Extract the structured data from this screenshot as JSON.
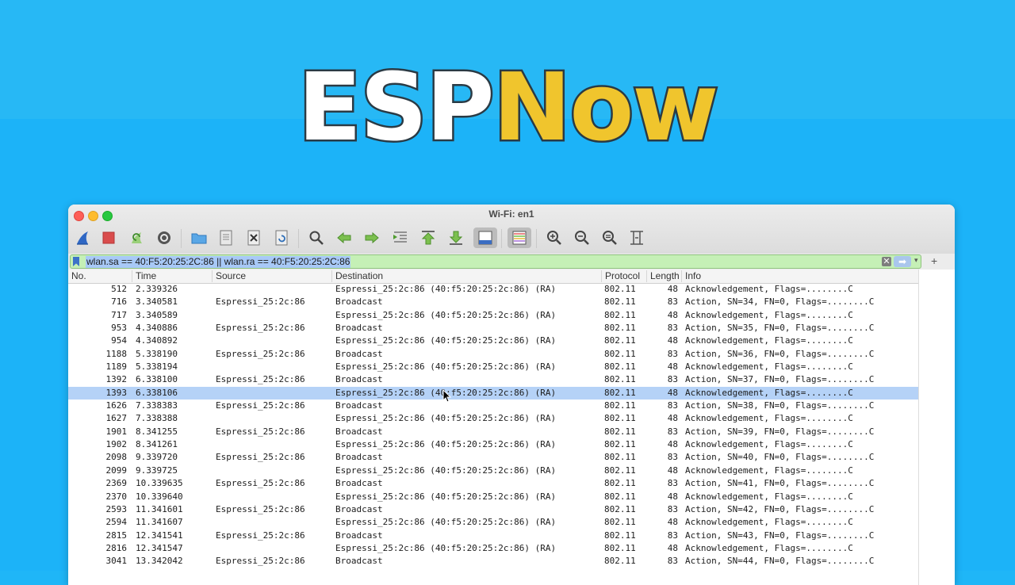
{
  "banner": {
    "title_part1": "ESP",
    "title_part2": "Now"
  },
  "window": {
    "title": "Wi-Fi: en1"
  },
  "toolbar": {
    "icons": [
      "shark-fin-icon",
      "stop-icon",
      "restart-icon",
      "options-gear-icon",
      "open-folder-icon",
      "save-file-icon",
      "close-file-icon",
      "reload-icon",
      "find-icon",
      "back-arrow-icon",
      "forward-arrow-icon",
      "go-to-packet-icon",
      "first-packet-icon",
      "last-packet-icon",
      "autoscroll-icon",
      "colorize-icon",
      "zoom-in-icon",
      "zoom-out-icon",
      "zoom-normal-icon",
      "resize-columns-icon"
    ]
  },
  "filter": {
    "value": "wlan.sa == 40:F5:20:25:2C:86 || wlan.ra == 40:F5:20:25:2C:86",
    "plus": "+"
  },
  "columns": [
    "No.",
    "Time",
    "Source",
    "Destination",
    "Protocol",
    "Length",
    "Info"
  ],
  "packets": [
    {
      "no": "512",
      "time": "2.339326",
      "src": "",
      "dst": "Espressi_25:2c:86 (40:f5:20:25:2c:86) (RA)",
      "proto": "802.11",
      "len": "48",
      "info": "Acknowledgement, Flags=........C"
    },
    {
      "no": "716",
      "time": "3.340581",
      "src": "Espressi_25:2c:86",
      "dst": "Broadcast",
      "proto": "802.11",
      "len": "83",
      "info": "Action, SN=34, FN=0, Flags=........C"
    },
    {
      "no": "717",
      "time": "3.340589",
      "src": "",
      "dst": "Espressi_25:2c:86 (40:f5:20:25:2c:86) (RA)",
      "proto": "802.11",
      "len": "48",
      "info": "Acknowledgement, Flags=........C"
    },
    {
      "no": "953",
      "time": "4.340886",
      "src": "Espressi_25:2c:86",
      "dst": "Broadcast",
      "proto": "802.11",
      "len": "83",
      "info": "Action, SN=35, FN=0, Flags=........C"
    },
    {
      "no": "954",
      "time": "4.340892",
      "src": "",
      "dst": "Espressi_25:2c:86 (40:f5:20:25:2c:86) (RA)",
      "proto": "802.11",
      "len": "48",
      "info": "Acknowledgement, Flags=........C"
    },
    {
      "no": "1188",
      "time": "5.338190",
      "src": "Espressi_25:2c:86",
      "dst": "Broadcast",
      "proto": "802.11",
      "len": "83",
      "info": "Action, SN=36, FN=0, Flags=........C"
    },
    {
      "no": "1189",
      "time": "5.338194",
      "src": "",
      "dst": "Espressi_25:2c:86 (40:f5:20:25:2c:86) (RA)",
      "proto": "802.11",
      "len": "48",
      "info": "Acknowledgement, Flags=........C"
    },
    {
      "no": "1392",
      "time": "6.338100",
      "src": "Espressi_25:2c:86",
      "dst": "Broadcast",
      "proto": "802.11",
      "len": "83",
      "info": "Action, SN=37, FN=0, Flags=........C"
    },
    {
      "no": "1393",
      "time": "6.338106",
      "src": "",
      "dst": "Espressi_25:2c:86 (40:f5:20:25:2c:86) (RA)",
      "proto": "802.11",
      "len": "48",
      "info": "Acknowledgement, Flags=........C",
      "selected": true
    },
    {
      "no": "1626",
      "time": "7.338383",
      "src": "Espressi_25:2c:86",
      "dst": "Broadcast",
      "proto": "802.11",
      "len": "83",
      "info": "Action, SN=38, FN=0, Flags=........C"
    },
    {
      "no": "1627",
      "time": "7.338388",
      "src": "",
      "dst": "Espressi_25:2c:86 (40:f5:20:25:2c:86) (RA)",
      "proto": "802.11",
      "len": "48",
      "info": "Acknowledgement, Flags=........C"
    },
    {
      "no": "1901",
      "time": "8.341255",
      "src": "Espressi_25:2c:86",
      "dst": "Broadcast",
      "proto": "802.11",
      "len": "83",
      "info": "Action, SN=39, FN=0, Flags=........C"
    },
    {
      "no": "1902",
      "time": "8.341261",
      "src": "",
      "dst": "Espressi_25:2c:86 (40:f5:20:25:2c:86) (RA)",
      "proto": "802.11",
      "len": "48",
      "info": "Acknowledgement, Flags=........C"
    },
    {
      "no": "2098",
      "time": "9.339720",
      "src": "Espressi_25:2c:86",
      "dst": "Broadcast",
      "proto": "802.11",
      "len": "83",
      "info": "Action, SN=40, FN=0, Flags=........C"
    },
    {
      "no": "2099",
      "time": "9.339725",
      "src": "",
      "dst": "Espressi_25:2c:86 (40:f5:20:25:2c:86) (RA)",
      "proto": "802.11",
      "len": "48",
      "info": "Acknowledgement, Flags=........C"
    },
    {
      "no": "2369",
      "time": "10.339635",
      "src": "Espressi_25:2c:86",
      "dst": "Broadcast",
      "proto": "802.11",
      "len": "83",
      "info": "Action, SN=41, FN=0, Flags=........C"
    },
    {
      "no": "2370",
      "time": "10.339640",
      "src": "",
      "dst": "Espressi_25:2c:86 (40:f5:20:25:2c:86) (RA)",
      "proto": "802.11",
      "len": "48",
      "info": "Acknowledgement, Flags=........C"
    },
    {
      "no": "2593",
      "time": "11.341601",
      "src": "Espressi_25:2c:86",
      "dst": "Broadcast",
      "proto": "802.11",
      "len": "83",
      "info": "Action, SN=42, FN=0, Flags=........C"
    },
    {
      "no": "2594",
      "time": "11.341607",
      "src": "",
      "dst": "Espressi_25:2c:86 (40:f5:20:25:2c:86) (RA)",
      "proto": "802.11",
      "len": "48",
      "info": "Acknowledgement, Flags=........C"
    },
    {
      "no": "2815",
      "time": "12.341541",
      "src": "Espressi_25:2c:86",
      "dst": "Broadcast",
      "proto": "802.11",
      "len": "83",
      "info": "Action, SN=43, FN=0, Flags=........C"
    },
    {
      "no": "2816",
      "time": "12.341547",
      "src": "",
      "dst": "Espressi_25:2c:86 (40:f5:20:25:2c:86) (RA)",
      "proto": "802.11",
      "len": "48",
      "info": "Acknowledgement, Flags=........C"
    },
    {
      "no": "3041",
      "time": "13.342042",
      "src": "Espressi_25:2c:86",
      "dst": "Broadcast",
      "proto": "802.11",
      "len": "83",
      "info": "Action, SN=44, FN=0, Flags=........C"
    }
  ],
  "colors": {
    "background": "#1fb6f7",
    "title_white": "#ffffff",
    "title_yellow": "#f0c52d",
    "filter_valid": "#c5f0b6",
    "selection": "#b5d2f7"
  }
}
